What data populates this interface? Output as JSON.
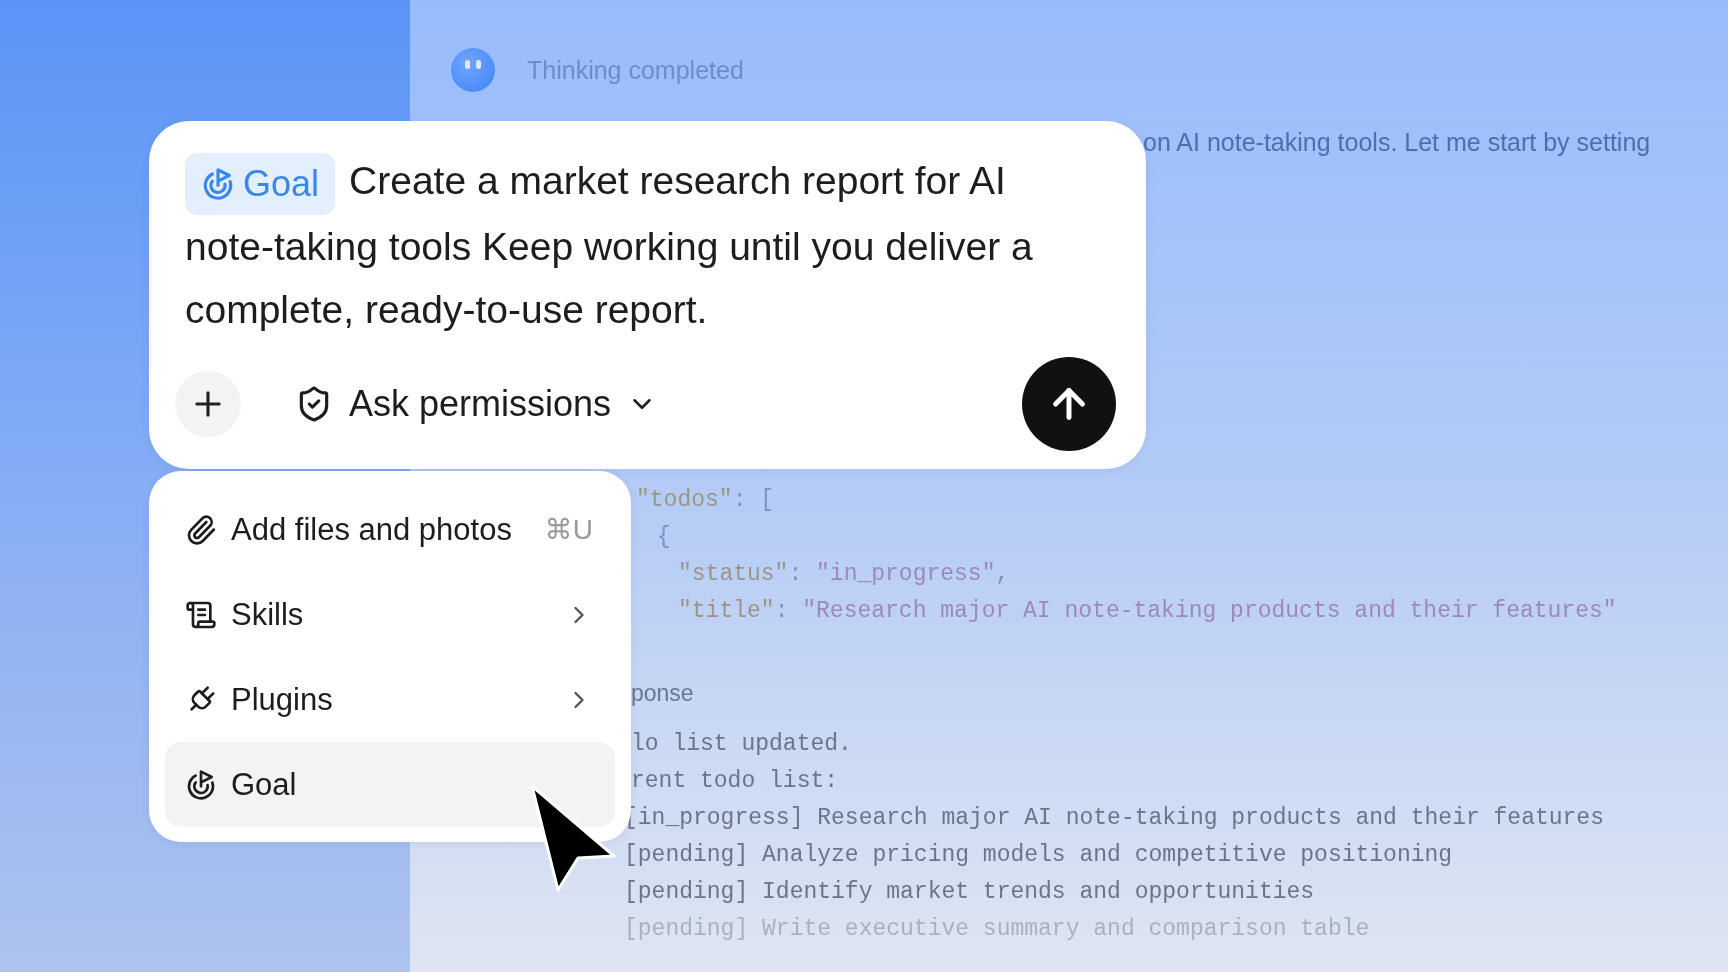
{
  "thinking": {
    "label": "Thinking completed"
  },
  "message": "on AI note-taking tools. Let me start by setting",
  "tool_call": {
    "lines": [
      {
        "kind": "outer",
        "tokens": [
          {
            "text": "\"todos\"",
            "kind": "key"
          },
          {
            "text": ": [",
            "kind": "punct"
          }
        ]
      },
      {
        "kind": "item",
        "tokens": [
          {
            "text": "{",
            "kind": "punct"
          }
        ]
      },
      {
        "kind": "field",
        "tokens": [
          {
            "text": "\"status\"",
            "kind": "key"
          },
          {
            "text": ": ",
            "kind": "punct"
          },
          {
            "text": "\"in_progress\"",
            "kind": "string"
          },
          {
            "text": ",",
            "kind": "punct"
          }
        ]
      },
      {
        "kind": "field",
        "tokens": [
          {
            "text": "\"title\"",
            "kind": "key"
          },
          {
            "text": ": ",
            "kind": "punct"
          },
          {
            "text": "\"Research major AI note-taking products and their features\"",
            "kind": "string"
          }
        ]
      }
    ]
  },
  "response": {
    "label": "ponse",
    "lines": [
      "lo list updated.",
      "rent todo list:",
      "[in_progress] Research major AI note-taking products and their features",
      "[pending] Analyze pricing models and competitive positioning",
      "[pending] Identify market trends and opportunities",
      "[pending] Write executive summary and comparison table"
    ]
  },
  "composer": {
    "goal_chip": "Goal",
    "prompt": "Create a market research report for AI note-taking tools Keep working until you deliver a complete, ready-to-use report.",
    "permissions": "Ask permissions"
  },
  "menu": [
    {
      "kind": "attach",
      "label": "Add files and photos",
      "shortcut": "⌘U",
      "submenu": false,
      "selected": false
    },
    {
      "kind": "skills",
      "label": "Skills",
      "submenu": true,
      "selected": false
    },
    {
      "kind": "plugins",
      "label": "Plugins",
      "submenu": true,
      "selected": false
    },
    {
      "kind": "goal",
      "label": "Goal",
      "submenu": false,
      "selected": true
    }
  ]
}
